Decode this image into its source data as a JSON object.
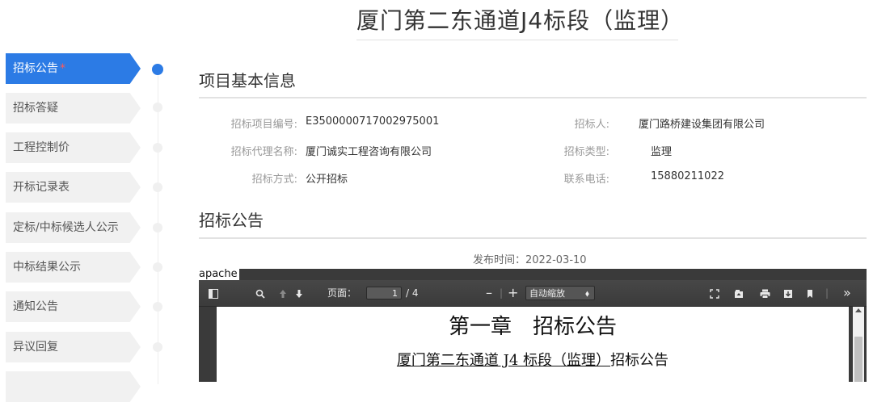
{
  "page": {
    "title": "厦门第二东通道J4标段（监理）"
  },
  "sidebar": {
    "items": [
      {
        "label": "招标公告",
        "active": true,
        "required_mark": "*"
      },
      {
        "label": "招标答疑"
      },
      {
        "label": "工程控制价"
      },
      {
        "label": "开标记录表"
      },
      {
        "label": "定标/中标候选人公示"
      },
      {
        "label": "中标结果公示"
      },
      {
        "label": "通知公告"
      },
      {
        "label": "异议回复"
      }
    ]
  },
  "basic_info": {
    "heading": "项目基本信息",
    "fields": [
      {
        "label": "招标项目编号:",
        "value": "E3500000717002975001"
      },
      {
        "label": "招标人:",
        "value": "厦门路桥建设集团有限公司"
      },
      {
        "label": "招标代理名称:",
        "value": "厦门诚实工程咨询有限公司"
      },
      {
        "label": "招标类型:",
        "value": "监理"
      },
      {
        "label": "招标方式:",
        "value": "公开招标"
      },
      {
        "label": "联系电话:",
        "value": "15880211022"
      }
    ]
  },
  "announcement": {
    "heading": "招标公告",
    "publish_label": "发布时间：",
    "publish_date": "2022-03-10"
  },
  "pdf_viewer": {
    "frame_label": "apache",
    "page_label": "页面：",
    "current_page": "1",
    "total_pages": "/ 4",
    "zoom_label": "自动缩放",
    "content": {
      "heading": "第一章　招标公告",
      "subheading_underlined": "厦门第二东通道 J4 标段（监理）",
      "subheading_rest": "招标公告"
    }
  },
  "colors": {
    "accent": "#2c7be5",
    "required_mark": "#ff5a5a",
    "toolbar": "#3b3b3b"
  }
}
